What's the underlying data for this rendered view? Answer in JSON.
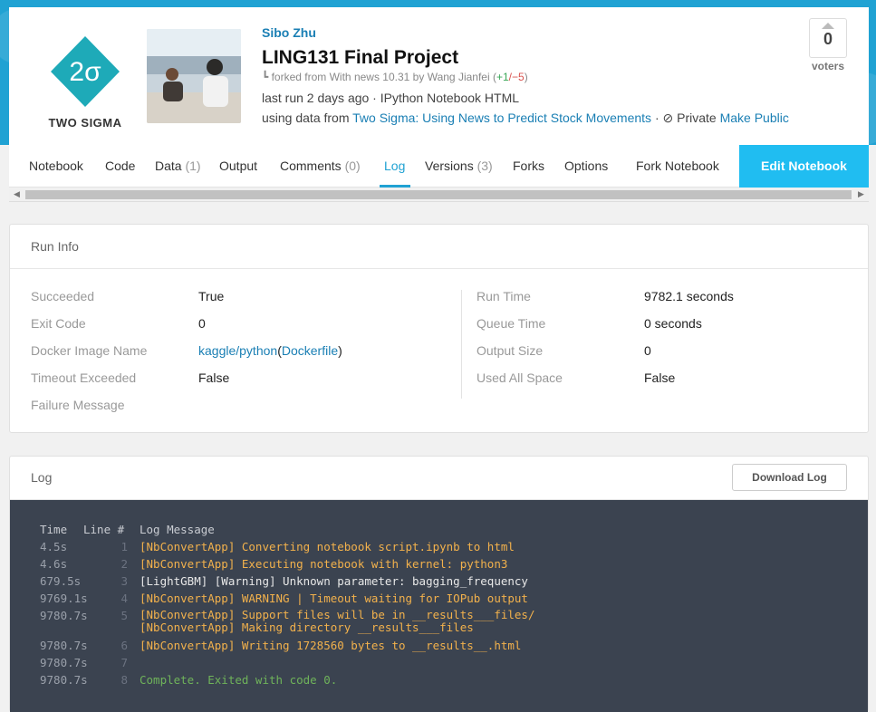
{
  "header": {
    "logo_text": "TWO SIGMA",
    "author": "Sibo Zhu",
    "title": "LING131 Final Project",
    "fork_prefix": "forked from",
    "fork_source": "With news 10.31",
    "fork_by": "by",
    "fork_author": "Wang Jianfei",
    "fork_open": "(",
    "fork_plus": "+1",
    "fork_minus": "/−5",
    "fork_close": ")",
    "run_info": "last run 2 days ago · IPython Notebook HTML",
    "data_prefix": "using data from",
    "data_source": "Two Sigma: Using News to Predict Stock Movements",
    "privacy_sep": "·",
    "privacy": "Private",
    "make_public": "Make Public",
    "votes": "0",
    "voters_label": "voters",
    "colors": {
      "brand": "#20a2d3",
      "edit_button": "#20bdf1"
    }
  },
  "tabs": [
    {
      "label": "Notebook",
      "count": ""
    },
    {
      "label": "Code",
      "count": ""
    },
    {
      "label": "Data",
      "count": "(1)"
    },
    {
      "label": "Output",
      "count": ""
    },
    {
      "label": "Comments",
      "count": "(0)"
    },
    {
      "label": "Log",
      "count": "",
      "active": true
    },
    {
      "label": "Versions",
      "count": "(3)"
    },
    {
      "label": "Forks",
      "count": ""
    },
    {
      "label": "Options",
      "count": ""
    },
    {
      "label": "Fork Notebook",
      "count": ""
    }
  ],
  "edit_button": "Edit Notebook",
  "run_info": {
    "title": "Run Info",
    "left": [
      {
        "label": "Succeeded",
        "value": "True"
      },
      {
        "label": "Exit Code",
        "value": "0"
      },
      {
        "label": "Docker Image Name",
        "value": "kaggle/python",
        "value_link2": "Dockerfile"
      },
      {
        "label": "Timeout Exceeded",
        "value": "False"
      },
      {
        "label": "Failure Message",
        "value": ""
      }
    ],
    "right": [
      {
        "label": "Run Time",
        "value": "9782.1 seconds"
      },
      {
        "label": "Queue Time",
        "value": "0 seconds"
      },
      {
        "label": "Output Size",
        "value": "0"
      },
      {
        "label": "Used All Space",
        "value": "False"
      }
    ]
  },
  "log": {
    "title": "Log",
    "download_label": "Download Log",
    "columns": {
      "time": "Time",
      "line": "Line #",
      "message": "Log Message"
    },
    "rows": [
      {
        "time": "4.5s",
        "line": "1",
        "message": "[NbConvertApp] Converting notebook script.ipynb to html",
        "color": "orange"
      },
      {
        "time": "4.6s",
        "line": "2",
        "message": "[NbConvertApp] Executing notebook with kernel: python3",
        "color": "orange"
      },
      {
        "time": "679.5s",
        "line": "3",
        "message": "[LightGBM] [Warning] Unknown parameter: bagging_frequency",
        "color": "white"
      },
      {
        "time": "9769.1s",
        "line": "4",
        "message": "[NbConvertApp] WARNING | Timeout waiting for IOPub output",
        "color": "orange"
      },
      {
        "time": "9780.7s",
        "line": "5",
        "message": "[NbConvertApp] Support files will be in __results___files/\n[NbConvertApp] Making directory __results___files",
        "color": "orange"
      },
      {
        "time": "9780.7s",
        "line": "6",
        "message": "[NbConvertApp] Writing 1728560 bytes to __results__.html",
        "color": "orange"
      },
      {
        "time": "9780.7s",
        "line": "7",
        "message": "",
        "color": "orange"
      },
      {
        "time": "9780.7s",
        "line": "8",
        "message": "Complete. Exited with code 0.",
        "color": "green"
      }
    ]
  }
}
